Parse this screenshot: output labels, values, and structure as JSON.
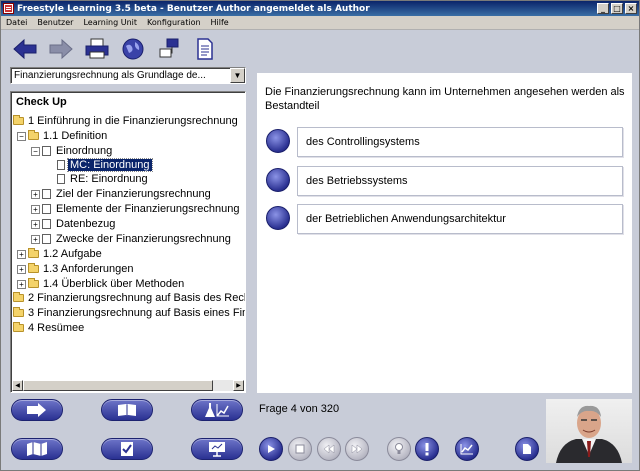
{
  "window": {
    "title": "Freestyle Learning 3.5 beta - Benutzer Author angemeldet als Author",
    "controls": [
      "_",
      "□",
      "×"
    ]
  },
  "menu": [
    "Datei",
    "Benutzer",
    "Learning Unit",
    "Konfiguration",
    "Hilfe"
  ],
  "toolbar": [
    "back-arrow-icon",
    "forward-arrow-icon",
    "printer-icon",
    "globe-icon",
    "network-icon",
    "document-icon"
  ],
  "unit_select": {
    "value": "Finanzierungsrechnung als Grundlage de..."
  },
  "tree": {
    "heading": "Check Up",
    "rows": [
      {
        "label": "1 Einführung in die Finanzierungsrechnung"
      },
      {
        "label": "1.1 Definition"
      },
      {
        "label": "Einordnung"
      },
      {
        "label": "MC: Einordnung",
        "selected": true
      },
      {
        "label": "RE: Einordnung"
      },
      {
        "label": "Ziel der Finanzierungsrechnung"
      },
      {
        "label": "Elemente der Finanzierungsrechnung"
      },
      {
        "label": "Datenbezug"
      },
      {
        "label": "Zwecke der Finanzierungsrechnung"
      },
      {
        "label": "1.2 Aufgabe"
      },
      {
        "label": "1.3 Anforderungen"
      },
      {
        "label": "1.4 Überblick über Methoden"
      },
      {
        "label": "2 Finanzierungsrechnung auf Basis des Rech"
      },
      {
        "label": "3 Finanzierungsrechnung auf Basis eines Fin"
      },
      {
        "label": "4 Resümee"
      }
    ]
  },
  "nav_buttons": [
    "enter-arrow-icon",
    "book-icon",
    "lab-chart-icon",
    "map-icon",
    "checklist-icon",
    "presentation-icon"
  ],
  "question": {
    "text": "Die Finanzierungsrechnung kann im Unternehmen angesehen werden als Bestandteil",
    "answers": [
      "des Controllingsystems",
      "des Betriebssystems",
      "der Betrieblichen Anwendungsarchitektur"
    ]
  },
  "status": {
    "progress": "Frage 4 von 320"
  },
  "controls": [
    "play-icon",
    "stop-icon",
    "rewind-icon",
    "fast-forward-icon",
    "lightbulb-icon",
    "exclamation-icon",
    "chart-icon",
    "page-icon"
  ]
}
